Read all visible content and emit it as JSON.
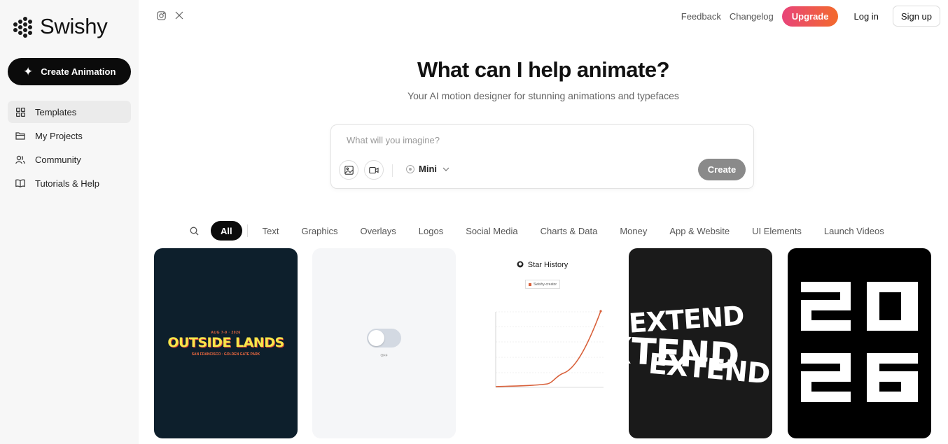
{
  "brand": {
    "name": "Swishy"
  },
  "sidebar": {
    "create_label": "Create Animation",
    "items": [
      {
        "label": "Templates",
        "icon": "grid-icon",
        "active": true
      },
      {
        "label": "My Projects",
        "icon": "folder-icon",
        "active": false
      },
      {
        "label": "Community",
        "icon": "users-icon",
        "active": false
      },
      {
        "label": "Tutorials & Help",
        "icon": "book-icon",
        "active": false
      }
    ]
  },
  "topbar": {
    "social": [
      "instagram-icon",
      "x-icon"
    ],
    "feedback": "Feedback",
    "changelog": "Changelog",
    "upgrade": "Upgrade",
    "login": "Log in",
    "signup": "Sign up"
  },
  "hero": {
    "title": "What can I help animate?",
    "subtitle": "Your AI motion designer for stunning animations and typefaces"
  },
  "prompt": {
    "placeholder": "What will you imagine?",
    "model": "Mini",
    "create": "Create"
  },
  "filters": [
    "All",
    "Text",
    "Graphics",
    "Overlays",
    "Logos",
    "Social Media",
    "Charts & Data",
    "Money",
    "App & Website",
    "UI Elements",
    "Launch Videos"
  ],
  "active_filter": "All",
  "cards": {
    "outside_lands": {
      "top": "AUG 7-9 · 2026",
      "main": "OUTSIDE LANDS",
      "bottom": "SAN FRANCISCO · GOLDEN GATE PARK"
    },
    "toggle": {
      "label": "OFF"
    },
    "star_history": {
      "title": "Star History",
      "legend": "Swishy-creator"
    },
    "extend": {
      "word": "EXTEND"
    },
    "year": {
      "top": "20",
      "bottom": "26"
    }
  },
  "colors": {
    "accent_start": "#e8447a",
    "accent_end": "#f36a2c",
    "primary": "#0b0b0b",
    "chart_line": "#d8603a"
  }
}
